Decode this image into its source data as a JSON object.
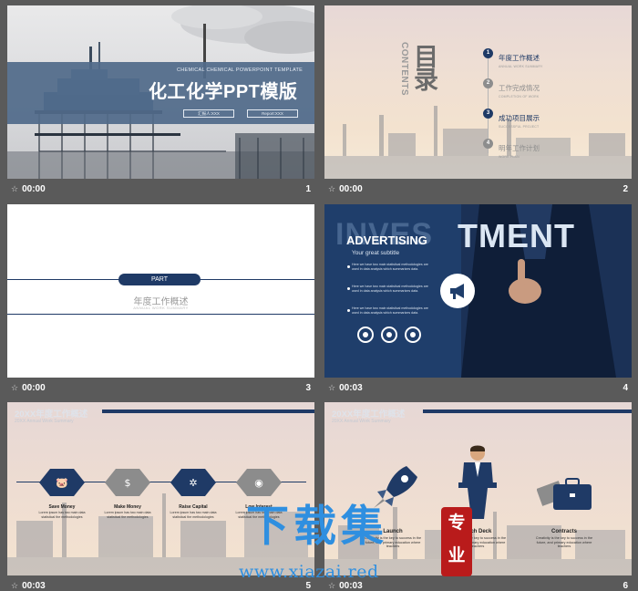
{
  "slides": [
    {
      "number": "1",
      "time": "00:00",
      "subtitle": "CHEMICAL CHEMICAL POWERPOINT TEMPLATE",
      "title": "化工化学PPT模版",
      "buttons": [
        "汇报人:XXX",
        "Report:XXX"
      ]
    },
    {
      "number": "2",
      "time": "00:00",
      "heading": "目录",
      "heading_en": "CONTENTS",
      "items": [
        {
          "num": "1",
          "label": "年度工作概述",
          "sub": "ANNUAL WORK SUMMARY"
        },
        {
          "num": "2",
          "label": "工作完成情况",
          "sub": "COMPLETION OF WORK"
        },
        {
          "num": "3",
          "label": "成功项目展示",
          "sub": "SUCCESSFUL PROJECT"
        },
        {
          "num": "4",
          "label": "明年工作计划",
          "sub": "WORK PLAN"
        }
      ]
    },
    {
      "number": "3",
      "time": "00:00",
      "part": "PART",
      "title": "年度工作概述",
      "title_en": "ANNUAL WORK SUMMARY"
    },
    {
      "number": "4",
      "time": "00:03",
      "bg_word_a": "INVES",
      "bg_word_b": "TMENT",
      "heading": "ADVERTISING",
      "subtitle": "Your great subtitle",
      "paragraphs": [
        "Here we have two main statistical methodologies are used in data analysis which summarizes data.",
        "Here we have two main statistical methodologies are used in data analysis which summarizes data.",
        "Here we have two main statistical methodologies are used in data analysis which summarizes data."
      ]
    },
    {
      "number": "5",
      "time": "00:03",
      "title": "20XX年度工作概述",
      "title_en": "20XX Annual Work Summary",
      "steps": [
        {
          "label": "Save Money",
          "text": "Lorem ipsum has two main data statistical the methodologies",
          "accent": "#1f3a66"
        },
        {
          "label": "Make Money",
          "text": "Lorem ipsum has two main data statistical the methodologies",
          "accent": "#8c8c8c"
        },
        {
          "label": "Raise Capital",
          "text": "Lorem ipsum has two main data statistical the methodologies",
          "accent": "#1f3a66"
        },
        {
          "label": "Low Interest",
          "text": "Lorem ipsum has two main data statistical the methodologies",
          "accent": "#8c8c8c"
        }
      ]
    },
    {
      "number": "6",
      "time": "00:03",
      "title": "20XX年度工作概述",
      "title_en": "20XX Annual Work Summary",
      "items": [
        {
          "label": "Launch",
          "text": "Creativity is the key to success in the future, and primary education where teachers"
        },
        {
          "label": "Pitch Deck",
          "text": "Creativity is the key to success in the future, and primary education where teachers"
        },
        {
          "label": "Contracts",
          "text": "Creativity is the key to success in the future, and primary education where teachers"
        }
      ]
    }
  ],
  "watermark": {
    "cn": "下载集",
    "seal_top": "专",
    "seal_bottom": "业",
    "url": "www.xiazai.red"
  },
  "colors": {
    "navy": "#1f3a66",
    "band": "#516a8a",
    "grey": "#8c8c8c",
    "watermark": "#2f8fe0",
    "seal": "#b91b1b"
  }
}
